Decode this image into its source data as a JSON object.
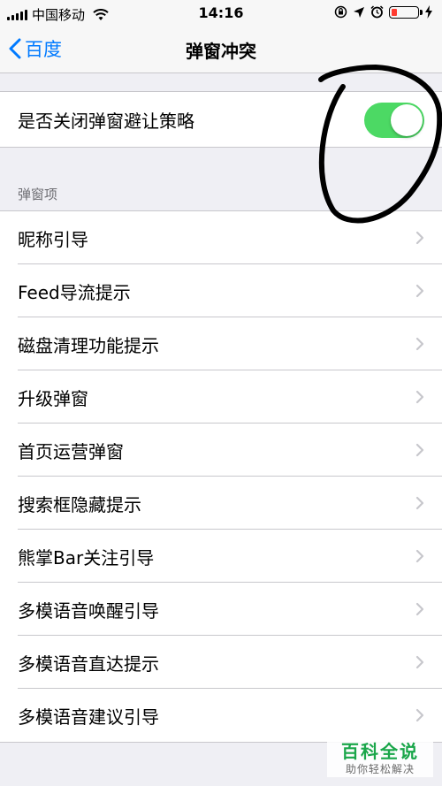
{
  "status_bar": {
    "carrier": "中国移动",
    "time": "14:16",
    "battery_color": "#ff3b30"
  },
  "nav": {
    "back_label": "百度",
    "title": "弹窗冲突"
  },
  "toggle_cell": {
    "label": "是否关闭弹窗避让策略",
    "on": true,
    "on_color": "#4cd964"
  },
  "section": {
    "header": "弹窗项",
    "items": [
      {
        "label": "昵称引导"
      },
      {
        "label": "Feed导流提示"
      },
      {
        "label": "磁盘清理功能提示"
      },
      {
        "label": "升级弹窗"
      },
      {
        "label": "首页运营弹窗"
      },
      {
        "label": "搜索框隐藏提示"
      },
      {
        "label": "熊掌Bar关注引导"
      },
      {
        "label": "多模语音唤醒引导"
      },
      {
        "label": "多模语音直达提示"
      },
      {
        "label": "多模语音建议引导"
      }
    ]
  },
  "watermark": {
    "title": "百科全说",
    "subtitle": "助你轻松解决"
  },
  "colors": {
    "accent": "#007aff",
    "background": "#efeff4",
    "separator": "#c8c7cc"
  }
}
